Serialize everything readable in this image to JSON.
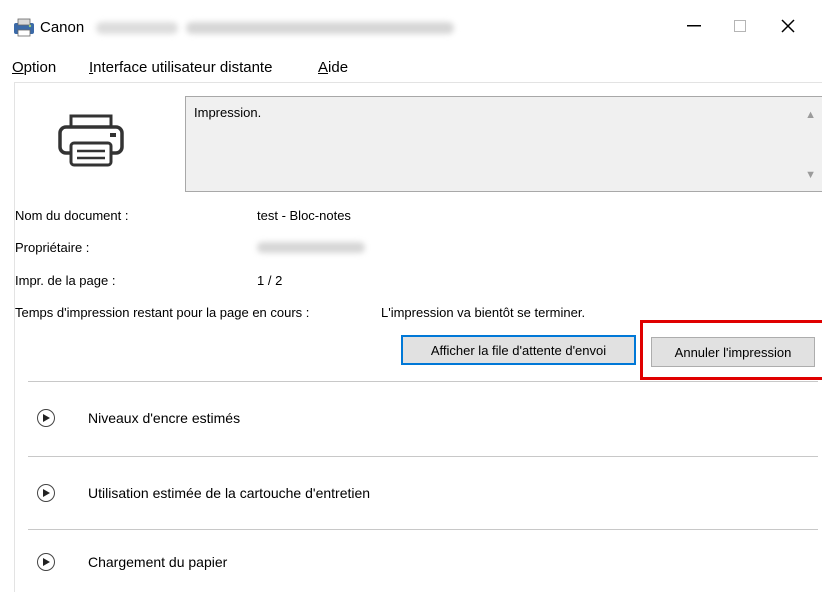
{
  "window": {
    "title": "Canon",
    "controls": {
      "minimize": "—",
      "maximize": "☐",
      "close": "✕"
    }
  },
  "menu": {
    "items": [
      {
        "mnemonic": "O",
        "rest": "ption"
      },
      {
        "mnemonic": "I",
        "rest": "nterface utilisateur distante"
      },
      {
        "mnemonic": "A",
        "rest": "ide"
      }
    ]
  },
  "status": {
    "message": "Impression.",
    "scroll_up": "▲",
    "scroll_down": "▼"
  },
  "info": {
    "document_label": "Nom du document :",
    "document_value": "test - Bloc-notes",
    "owner_label": "Propriétaire :",
    "page_label": "Impr. de la page :",
    "page_value": "1 / 2",
    "time_label": "Temps d'impression restant pour la page en cours :",
    "time_value": "L'impression va bientôt se terminer."
  },
  "buttons": {
    "queue": "Afficher la file d'attente d'envoi",
    "cancel": "Annuler l'impression"
  },
  "sections": [
    {
      "label": "Niveaux d'encre estimés"
    },
    {
      "label": "Utilisation estimée de la cartouche d'entretien"
    },
    {
      "label": "Chargement du papier"
    }
  ],
  "colors": {
    "highlight": "#e00000",
    "focus_border": "#0078d7"
  }
}
